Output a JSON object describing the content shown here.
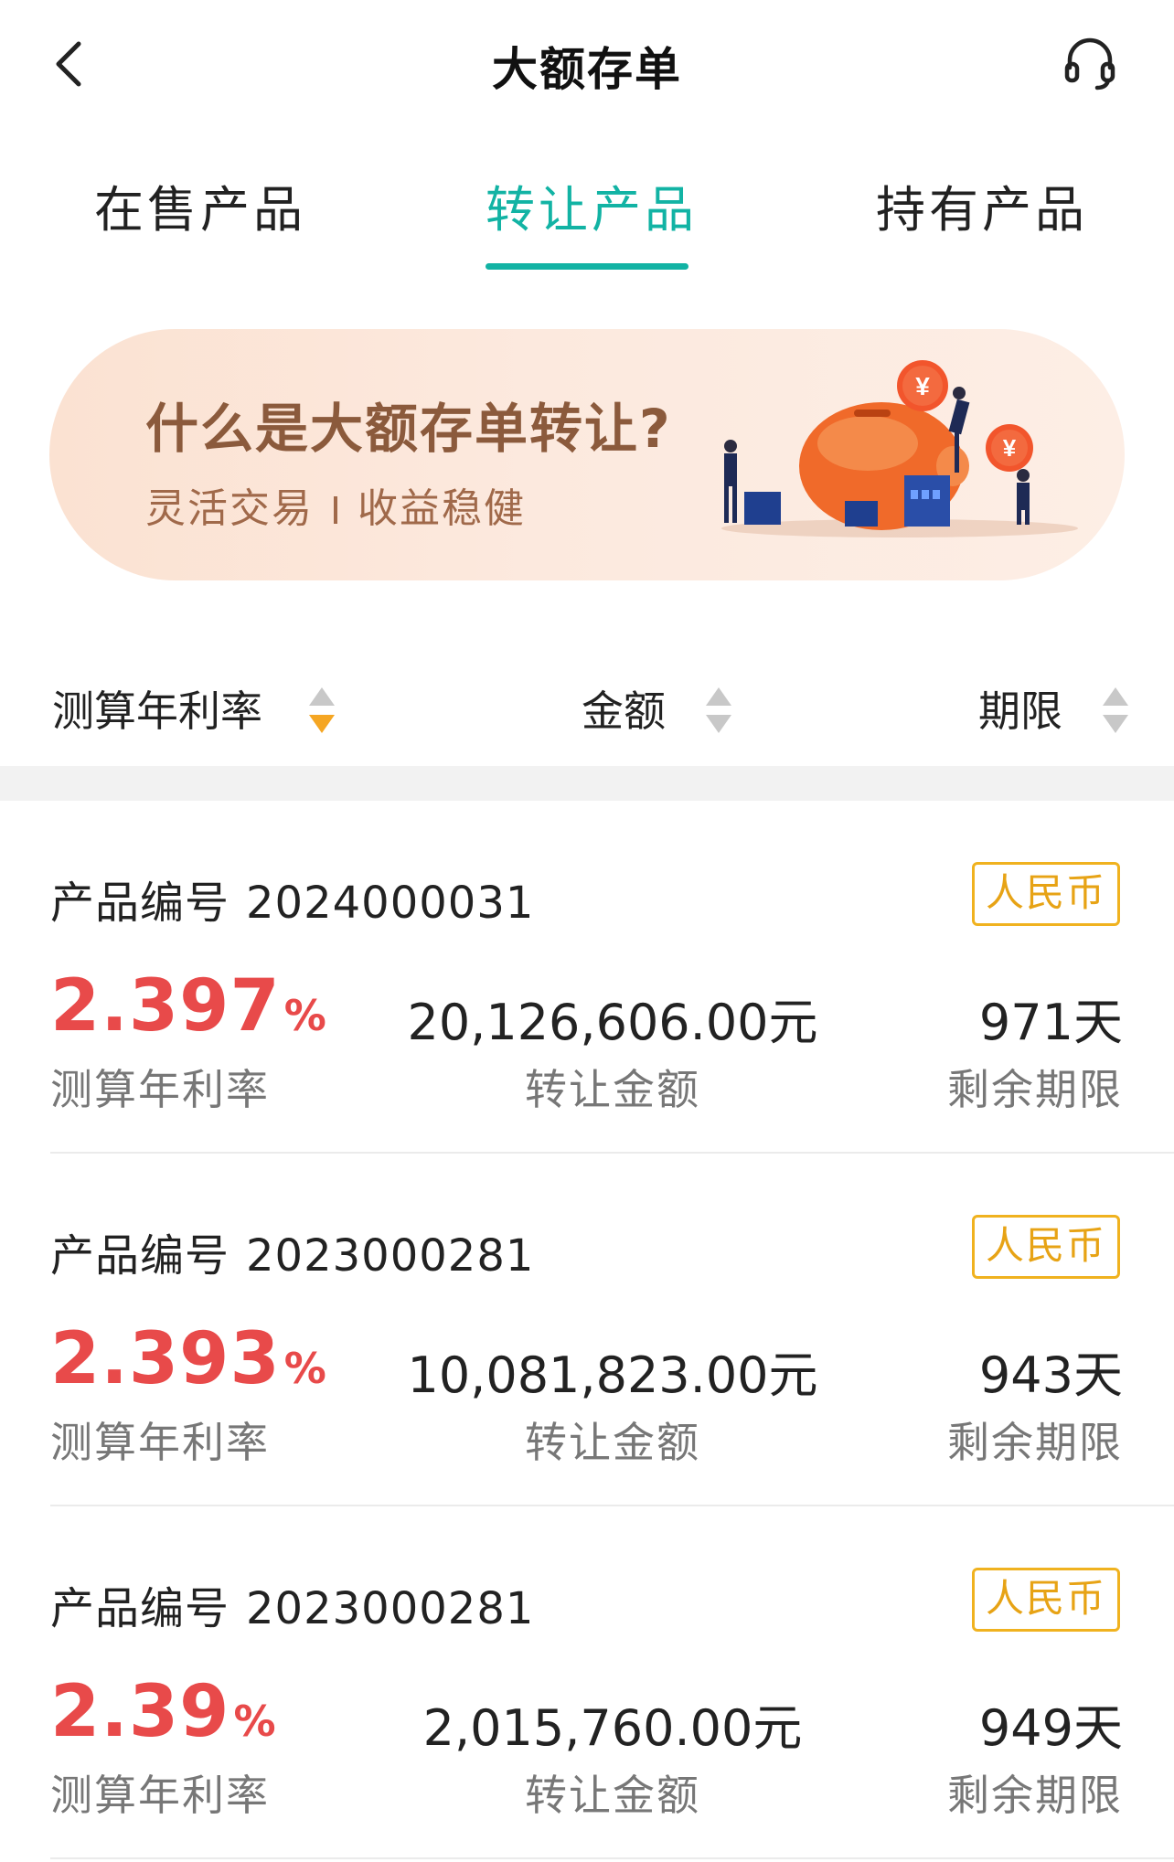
{
  "header": {
    "title": "大额存单",
    "back_icon": "chevron-left-icon",
    "service_icon": "headset-icon"
  },
  "tabs": [
    {
      "label": "在售产品",
      "active": false
    },
    {
      "label": "转让产品",
      "active": true
    },
    {
      "label": "持有产品",
      "active": false
    }
  ],
  "banner": {
    "title": "什么是大额存单转让?",
    "sub_left": "灵活交易",
    "sub_right": "收益稳健",
    "coin_symbol": "¥"
  },
  "sort_bar": {
    "rate_label": "测算年利率",
    "amount_label": "金额",
    "term_label": "期限",
    "active_sort": "rate-desc"
  },
  "colors": {
    "accent": "#12b3a4",
    "rate_red": "#e84a4a",
    "badge_gold": "#f0b21f",
    "sort_active": "#f5a623",
    "sort_inactive": "#c8c8c8"
  },
  "products": [
    {
      "code_label": "产品编号",
      "code": "2024000031",
      "currency": "人民币",
      "rate": "2.397",
      "rate_unit": "%",
      "rate_label": "测算年利率",
      "amount": "20,126,606.00元",
      "amount_label": "转让金额",
      "term": "971天",
      "term_label": "剩余期限"
    },
    {
      "code_label": "产品编号",
      "code": "2023000281",
      "currency": "人民币",
      "rate": "2.393",
      "rate_unit": "%",
      "rate_label": "测算年利率",
      "amount": "10,081,823.00元",
      "amount_label": "转让金额",
      "term": "943天",
      "term_label": "剩余期限"
    },
    {
      "code_label": "产品编号",
      "code": "2023000281",
      "currency": "人民币",
      "rate": "2.39",
      "rate_unit": "%",
      "rate_label": "测算年利率",
      "amount": "2,015,760.00元",
      "amount_label": "转让金额",
      "term": "949天",
      "term_label": "剩余期限"
    }
  ]
}
